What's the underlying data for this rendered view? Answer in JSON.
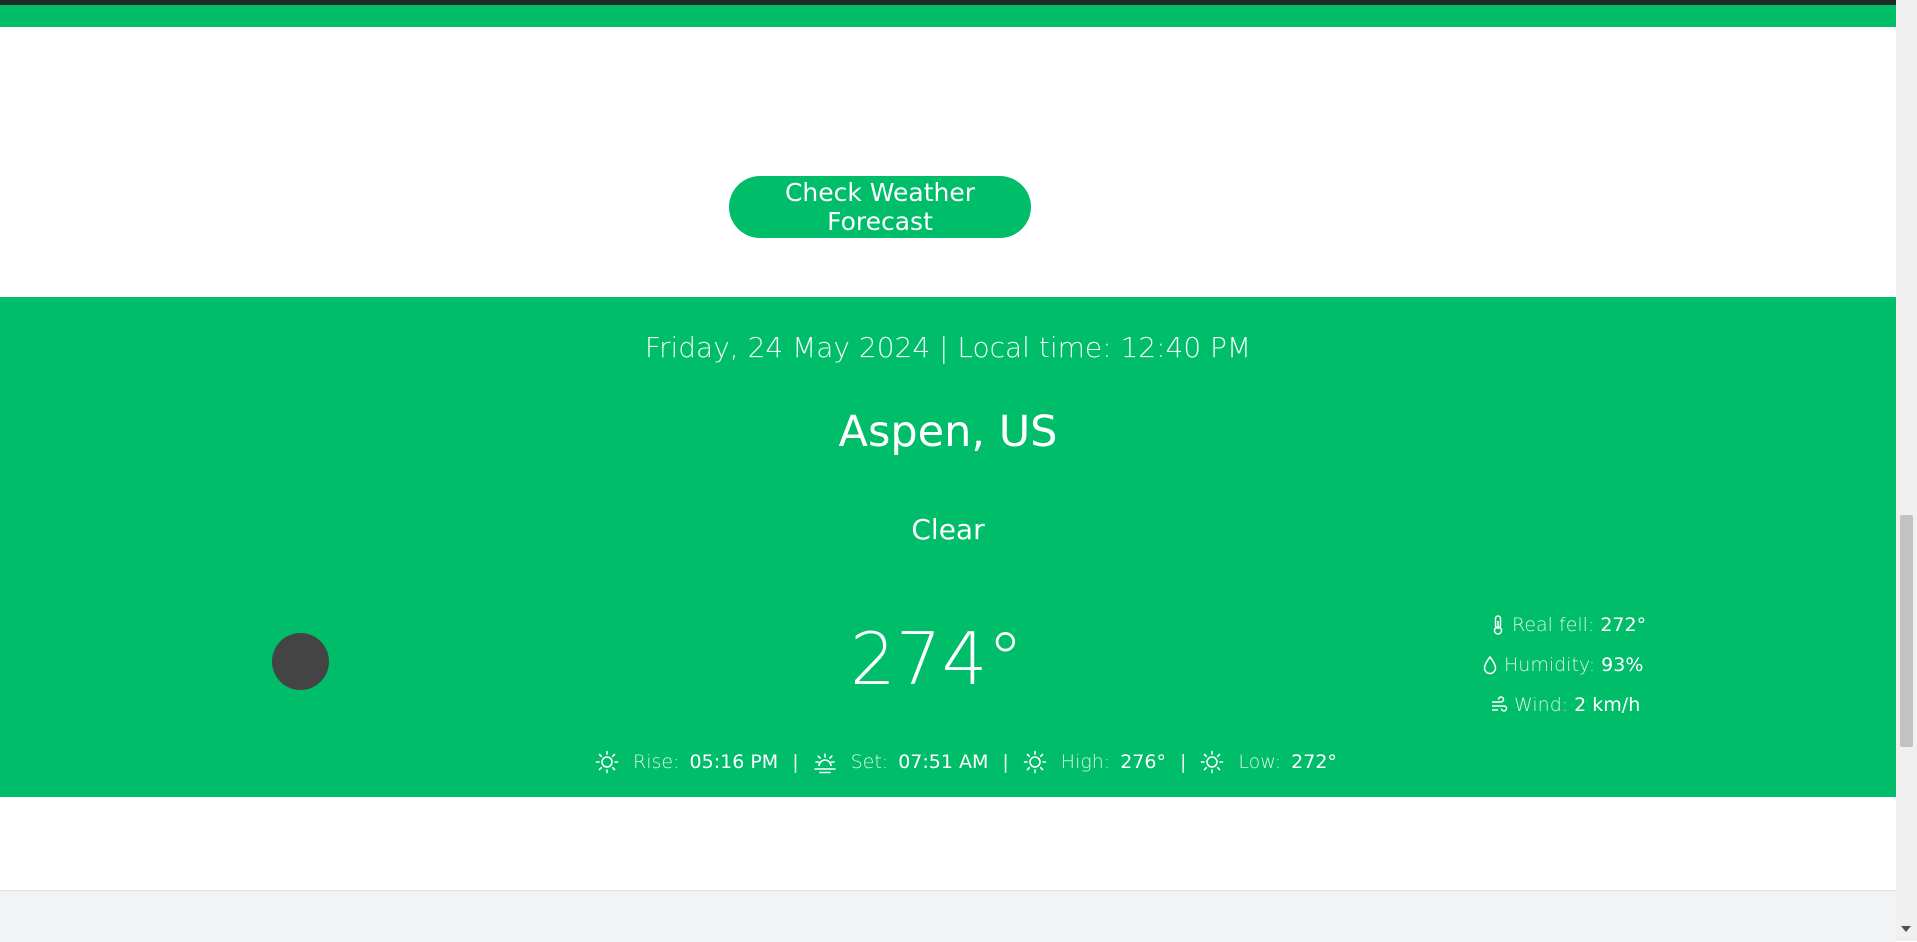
{
  "colors": {
    "accent": "#00bd6a",
    "icon_dark": "#444444",
    "footer": "#f2f3f5"
  },
  "button": {
    "label": "Check Weather Forecast"
  },
  "weather": {
    "datetime": "Friday, 24 May 2024 | Local time: 12:40 PM",
    "location": "Aspen, US",
    "condition": "Clear",
    "temperature": "274°",
    "details": [
      {
        "icon": "thermometer-icon",
        "label": "Real fell:",
        "value": "272°"
      },
      {
        "icon": "droplet-icon",
        "label": "Humidity:",
        "value": "93%"
      },
      {
        "icon": "wind-icon",
        "label": "Wind:",
        "value": "2 km/h"
      }
    ],
    "bottom": [
      {
        "icon": "sun-icon",
        "label": "Rise:",
        "value": "05:16 PM"
      },
      {
        "icon": "sunset-icon",
        "label": "Set:",
        "value": "07:51 AM"
      },
      {
        "icon": "sun-icon",
        "label": "High:",
        "value": "276°"
      },
      {
        "icon": "sun-icon",
        "label": "Low:",
        "value": "272°"
      }
    ],
    "separator": "|"
  }
}
